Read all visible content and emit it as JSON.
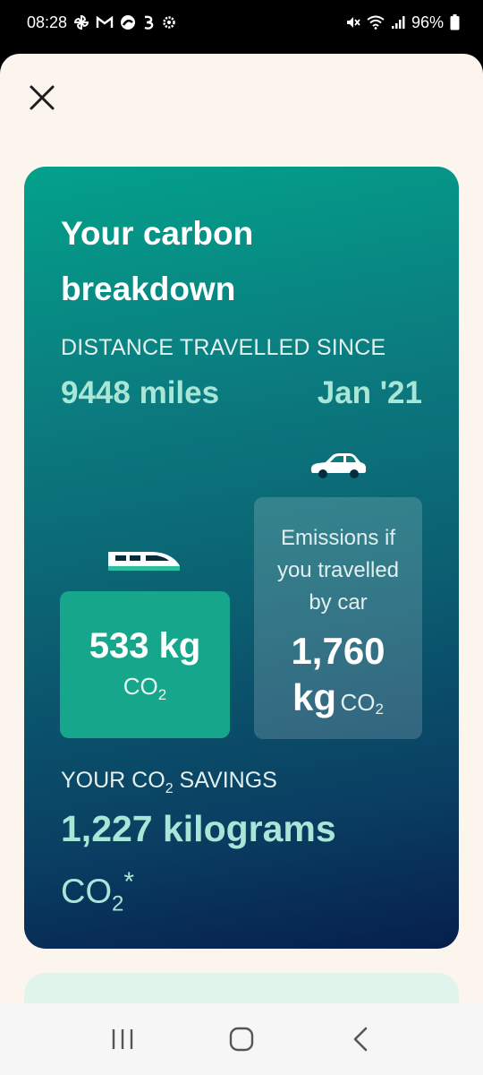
{
  "status_bar": {
    "time": "08:28",
    "battery": "96%",
    "left_icons": [
      "pinwheel-icon",
      "gmail-icon",
      "app-icon",
      "three-icon",
      "settings-icon"
    ],
    "right_icons": [
      "mute-icon",
      "wifi-icon",
      "signal-icon",
      "battery-icon"
    ]
  },
  "card": {
    "title_line1": "Your carbon",
    "title_line2": "breakdown",
    "distance_label": "DISTANCE TRAVELLED SINCE",
    "distance_value": "9448 miles",
    "distance_since": "Jan '21",
    "train": {
      "icon": "train-icon",
      "amount": "533 kg",
      "unit_prefix": "CO",
      "unit_subscript": "2"
    },
    "car": {
      "icon": "car-icon",
      "label": "Emissions if you travelled by car",
      "amount": "1,760",
      "unit_big": "kg",
      "unit_small": "CO",
      "unit_subscript": "2"
    },
    "savings": {
      "label_prefix": "YOUR CO",
      "label_subscript": "2",
      "label_suffix": " SAVINGS",
      "value": "1,227 kilograms",
      "unit_prefix": "CO",
      "unit_subscript": "2",
      "unit_suffix": "*"
    }
  },
  "colors": {
    "accent_green": "#16a68b",
    "highlight_text": "#a8e6d7",
    "sheet_bg": "#fcf5ee"
  },
  "nav": {
    "recent_icon": "recent-apps-icon",
    "home_icon": "home-icon",
    "back_icon": "back-icon"
  }
}
